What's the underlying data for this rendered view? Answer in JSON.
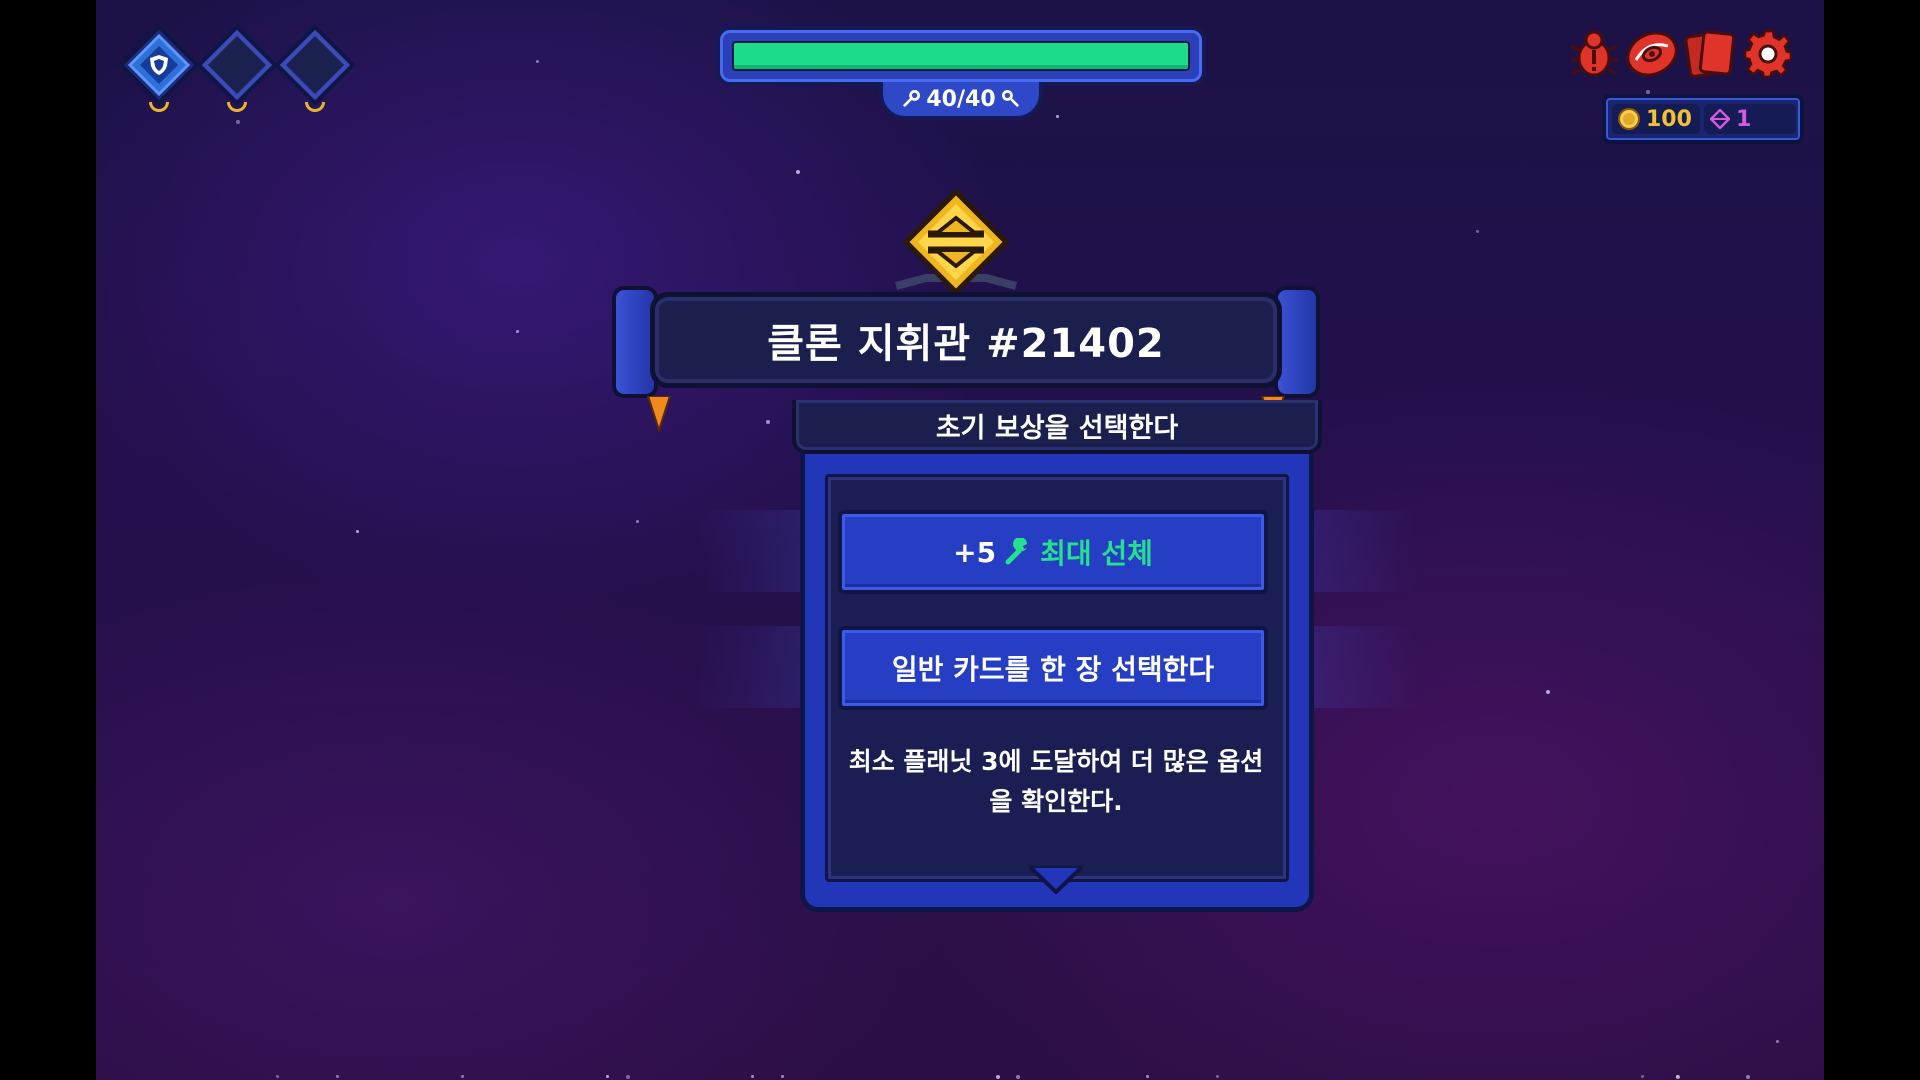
{
  "header": {
    "hull": {
      "current": 40,
      "max": 40,
      "label": "40/40",
      "fill_fraction": 1.0,
      "color": "#1bdc8b"
    },
    "map_nodes": [
      {
        "name": "node-1",
        "state": "active",
        "icon": "shield-icon"
      },
      {
        "name": "node-2",
        "state": "empty"
      },
      {
        "name": "node-3",
        "state": "empty"
      }
    ],
    "menu_icons": [
      "bug-report-icon",
      "galaxy-map-icon",
      "card-deck-icon",
      "settings-gear-icon"
    ],
    "gold": "100",
    "gems": "1"
  },
  "event": {
    "title": "클론 지휘관 #21402",
    "subtitle": "초기 보상을 선택한다",
    "options": [
      {
        "prefix": "+5",
        "label": "최대 선체",
        "icon": "wrench-icon",
        "highlight_color": "#25e08f"
      },
      {
        "prefix": "",
        "label": "일반 카드를 한 장 선택한다"
      }
    ],
    "info_line1": "최소 플래닛 3에 도달하여 더 많은 옵션",
    "info_line2": "을 확인한다."
  },
  "colors": {
    "accent_blue": "#263ec4",
    "gold": "#f2c232",
    "gem": "#d05ae0",
    "menu_red": "#e0342b"
  }
}
